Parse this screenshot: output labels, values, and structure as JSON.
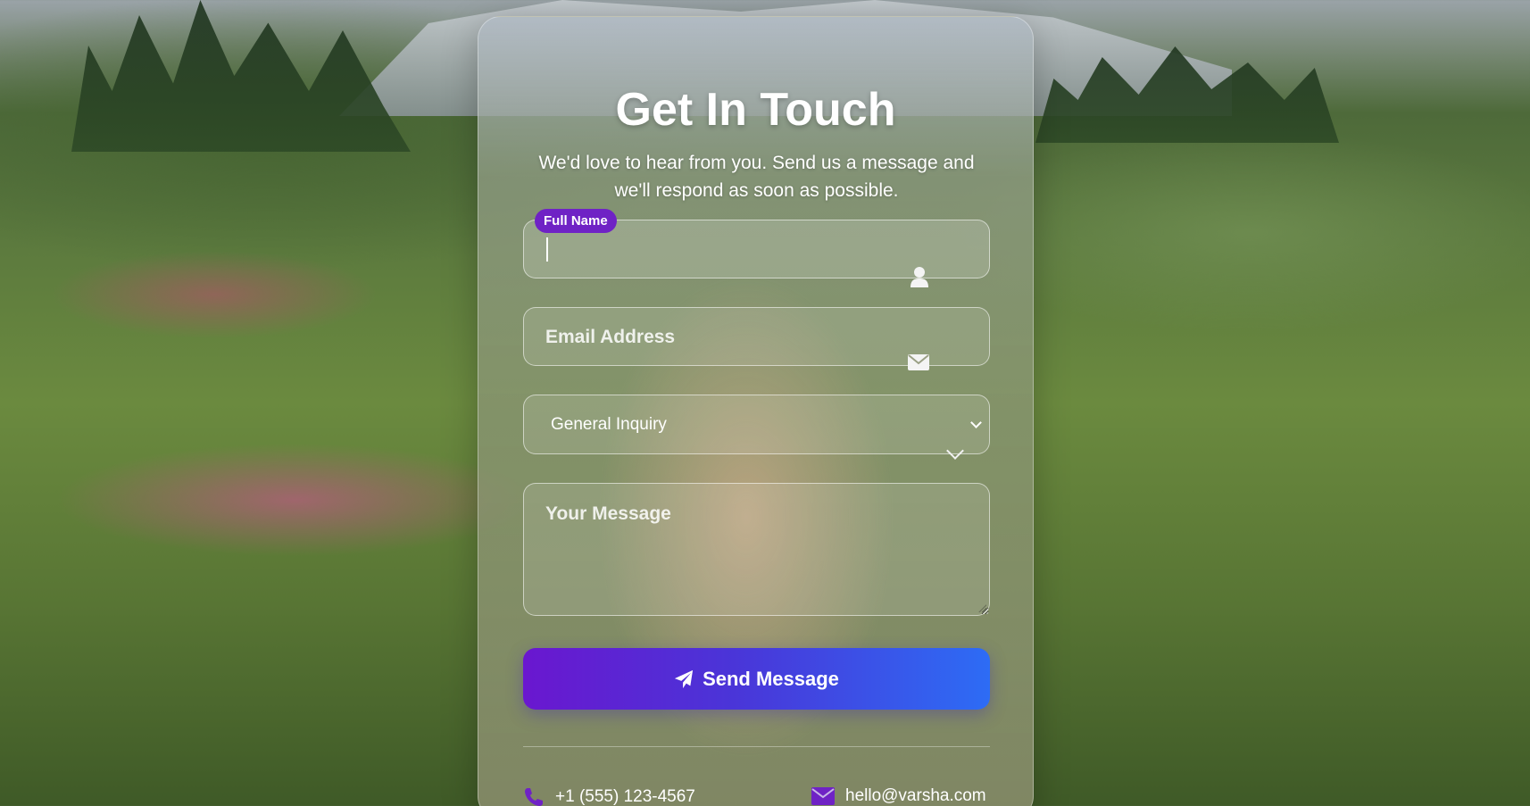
{
  "heading": "Get In Touch",
  "subtitle_line1": "We'd love to hear from you. Send us a message and",
  "subtitle_line2": "we'll respond as soon as possible.",
  "form": {
    "name": {
      "label": "Full Name",
      "value": "",
      "icon": "user-icon"
    },
    "email": {
      "placeholder": "Email Address",
      "value": "",
      "icon": "envelope-icon"
    },
    "subject": {
      "selected": "General Inquiry",
      "icon": "chevron-down-icon"
    },
    "message": {
      "placeholder": "Your Message",
      "value": ""
    },
    "submit": {
      "label": "Send Message",
      "icon": "paper-plane-icon"
    }
  },
  "contact": {
    "phone": "+1 (555) 123-4567",
    "email": "hello@varsha.com"
  },
  "colors": {
    "accent_purple": "#6f22c5",
    "button_start": "#6a17cf",
    "button_end": "#2d6cf5"
  }
}
